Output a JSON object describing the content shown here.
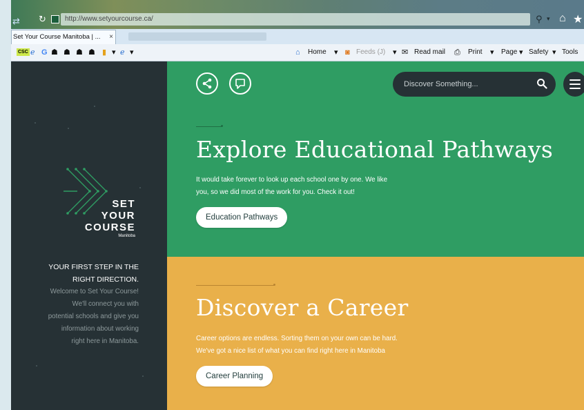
{
  "browser": {
    "url": "http://www.setyourcourse.ca/",
    "tab_title": "Set Your Course Manitoba | ...",
    "tab_close": "×",
    "toolbar": {
      "csc": "CSC",
      "home": "Home",
      "feeds": "Feeds (J)",
      "read_mail": "Read mail",
      "print": "Print",
      "page": "Page",
      "safety": "Safety",
      "tools": "Tools"
    }
  },
  "sidebar": {
    "logo_lines": [
      "SET",
      "YOUR",
      "COURSE"
    ],
    "logo_sub": "Manitoba",
    "tagline_lines": [
      "YOUR FIRST STEP IN THE",
      "RIGHT DIRECTION."
    ],
    "welcome_lines": [
      "Welcome to Set Your Course!",
      "We'll connect you with",
      "potential schools and give you",
      "information about working",
      "right here in Manitoba."
    ]
  },
  "header": {
    "search_placeholder": "Discover Something..."
  },
  "sections": [
    {
      "title": "Explore Educational Pathways",
      "text_lines": [
        "It would take forever to look up each school one by one. We like",
        "you, so we did most of the work for you. Check it out!"
      ],
      "button": "Education Pathways"
    },
    {
      "title": "Discover a Career",
      "text_lines": [
        "Career options are endless. Sorting them on your own can be hard.",
        "We've got a nice list of what you can find right here in Manitoba"
      ],
      "button": "Career Planning"
    }
  ],
  "colors": {
    "sidebar": "#263135",
    "green": "#2f9d63",
    "yellow": "#e9b04a"
  }
}
